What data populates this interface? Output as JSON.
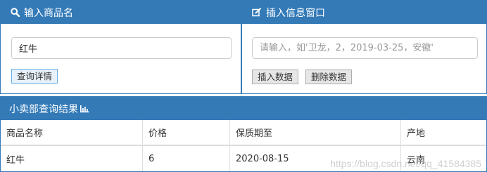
{
  "query_panel": {
    "title": "输入商品名",
    "icon": "search-icon",
    "input_value": "红牛",
    "button_label": "查询详情"
  },
  "insert_panel": {
    "title": "插入信息窗口",
    "icon": "edit-icon",
    "placeholder": "请输入，如'卫龙，2，2019-03-25，安徽'",
    "insert_label": "插入数据",
    "delete_label": "删除数据"
  },
  "result_panel": {
    "title": "小卖部查询结果",
    "icon": "bar-chart-icon",
    "headers": [
      "商品名称",
      "价格",
      "保质期至",
      "产地"
    ],
    "rows": [
      [
        "红牛",
        "6",
        "2020-08-15",
        "云南"
      ]
    ]
  },
  "watermark": "https://blog.csdn.net/qq_41584385",
  "colors": {
    "accent": "#337ab7",
    "button_bg": "#e6e6e6"
  }
}
